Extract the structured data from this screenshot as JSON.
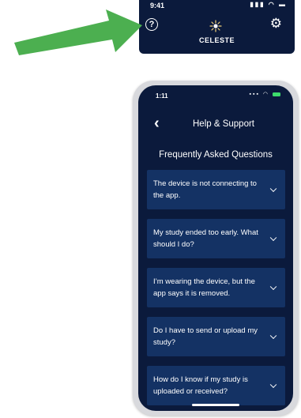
{
  "top_header": {
    "time": "9:41",
    "status_icons": "▮▮▮ ◠ ▬",
    "help_glyph": "?",
    "logo_text": "CELESTE",
    "gear_glyph": "⚙"
  },
  "phone": {
    "status_bar": {
      "time": "1:11",
      "icons": "▪▪▪ ◠"
    },
    "nav": {
      "back_glyph": "‹",
      "title": "Help & Support"
    },
    "section_title": "Frequently Asked Questions",
    "faq": [
      {
        "question": "The device is not connecting to the app."
      },
      {
        "question": "My study ended too early. What should I do?"
      },
      {
        "question": "I’m wearing the device, but the app says it is removed."
      },
      {
        "question": "Do I have to send or upload my study?"
      },
      {
        "question": "How do I know if my study is uploaded or received?"
      }
    ]
  },
  "colors": {
    "app_background": "#0b1a3c",
    "faq_card": "#143264",
    "arrow": "#4caf50",
    "battery": "#3ddc6c"
  },
  "icons": {
    "help": "help-circle-icon",
    "settings": "gear-icon",
    "logo": "sun-star-logo",
    "back": "chevron-left-icon",
    "expand": "chevron-down-icon",
    "callout": "green-arrow"
  }
}
